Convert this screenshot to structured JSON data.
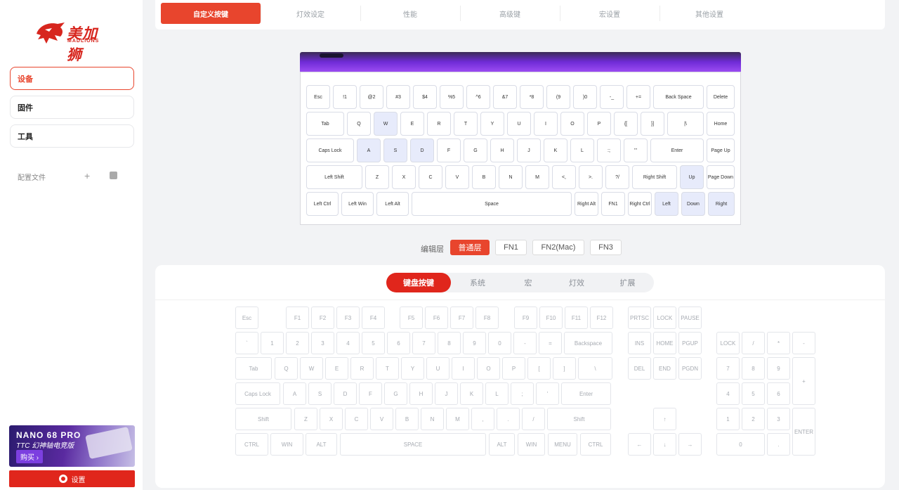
{
  "brand": {
    "name_cn": "美加狮",
    "name_en": "MADLIONS"
  },
  "sidebar": {
    "items": [
      {
        "label": "设备"
      },
      {
        "label": "固件"
      },
      {
        "label": "工具"
      }
    ],
    "config_label": "配置文件",
    "plus": "+",
    "ad": {
      "title": "NANO 68 PRO",
      "subtitle": "TTC 幻神轴电竞版",
      "buy": "购买 ›"
    },
    "settings_label": "设置"
  },
  "tabs": [
    {
      "label": "自定义按键"
    },
    {
      "label": "灯效设定"
    },
    {
      "label": "性能"
    },
    {
      "label": "高级键"
    },
    {
      "label": "宏设置"
    },
    {
      "label": "其他设置"
    }
  ],
  "keyboard": {
    "rows": [
      [
        "Esc",
        "!1",
        "@2",
        "#3",
        "$4",
        "%5",
        "^6",
        "&7",
        "*8",
        "(9",
        ")0",
        "-_",
        "+=",
        "Back Space",
        "Delete"
      ],
      [
        "Tab",
        "Q",
        "W",
        "E",
        "R",
        "T",
        "Y",
        "U",
        "I",
        "O",
        "P",
        "{[",
        "}]",
        "|\\",
        "Home"
      ],
      [
        "Caps Lock",
        "A",
        "S",
        "D",
        "F",
        "G",
        "H",
        "J",
        "K",
        "L",
        ":;",
        "\"'",
        "Enter",
        "Page Up"
      ],
      [
        "Left Shift",
        "Z",
        "X",
        "C",
        "V",
        "B",
        "N",
        "M",
        "<,",
        ">.",
        "?/",
        "Right Shift",
        "Up",
        "Page Down"
      ],
      [
        "Left Ctrl",
        "Left Win",
        "Left Alt",
        "Space",
        "Right Alt",
        "FN1",
        "Right Ctrl",
        "Left",
        "Down",
        "Right"
      ]
    ]
  },
  "layers": {
    "label": "编辑层",
    "items": [
      {
        "label": "普通层"
      },
      {
        "label": "FN1"
      },
      {
        "label": "FN2(Mac)"
      },
      {
        "label": "FN3"
      }
    ]
  },
  "panel": {
    "subtabs": [
      {
        "label": "键盘按键"
      },
      {
        "label": "系统"
      },
      {
        "label": "宏"
      },
      {
        "label": "灯效"
      },
      {
        "label": "扩展"
      }
    ],
    "keys": {
      "fn": [
        "Esc",
        "F1",
        "F2",
        "F3",
        "F4",
        "F5",
        "F6",
        "F7",
        "F8",
        "F9",
        "F10",
        "F11",
        "F12",
        "PRTSC",
        "LOCK",
        "PAUSE"
      ],
      "num": [
        "`",
        "1",
        "2",
        "3",
        "4",
        "5",
        "6",
        "7",
        "8",
        "9",
        "0",
        "-",
        "=",
        "Backspace",
        "INS",
        "HOME",
        "PGUP",
        "LOCK",
        "/",
        "*",
        "-"
      ],
      "tab": [
        "Tab",
        "Q",
        "W",
        "E",
        "R",
        "T",
        "Y",
        "U",
        "I",
        "O",
        "P",
        "[",
        "]",
        "\\",
        "DEL",
        "END",
        "PGDN",
        "7",
        "8",
        "9",
        "+"
      ],
      "caps": [
        "Caps Lock",
        "A",
        "S",
        "D",
        "F",
        "G",
        "H",
        "J",
        "K",
        "L",
        ";",
        "'",
        "Enter",
        "4",
        "5",
        "6"
      ],
      "shift": [
        "Shift",
        "Z",
        "X",
        "C",
        "V",
        "B",
        "N",
        "M",
        ",",
        ".",
        "/",
        "Shift",
        "↑",
        "1",
        "2",
        "3",
        "ENTER"
      ],
      "ctrl": [
        "CTRL",
        "WIN",
        "ALT",
        "SPACE",
        "ALT",
        "WIN",
        "MENU",
        "CTRL",
        "←",
        "↓",
        "→",
        "0",
        "."
      ]
    }
  },
  "colors": {
    "accent": "#e8452d",
    "highlight_key": "#e7ebfb",
    "keyboard_glow": "#9b4bf2"
  }
}
